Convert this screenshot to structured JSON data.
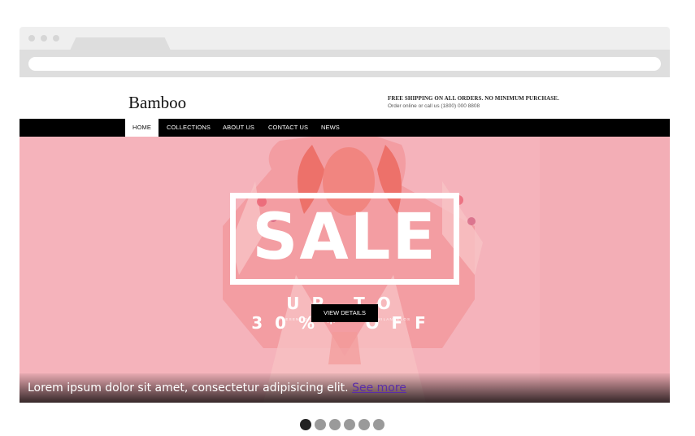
{
  "site": {
    "logo": "Bamboo",
    "promo_line1": "FREE SHIPPING ON ALL ORDERS. NO MINIMUM PURCHASE.",
    "promo_line2": "Order online or call us (1800) 000 8808"
  },
  "nav": {
    "items": [
      {
        "label": "HOME",
        "active": true
      },
      {
        "label": "COLLECTIONS",
        "active": false
      },
      {
        "label": "ABOUT US",
        "active": false
      },
      {
        "label": "CONTACT US",
        "active": false
      },
      {
        "label": "NEWS",
        "active": false
      }
    ]
  },
  "hero": {
    "sale_text": "SALE",
    "offer_text": "UP TO 30%* OFF",
    "fine_print": "PRESENT DAPIBUS ... ... ... ... ... ... MILANCELOS",
    "button_label": "VIEW DETAILS",
    "background_color": "#f5b3bb"
  },
  "caption": {
    "text": "Lorem ipsum dolor sit amet, consectetur adipisicing elit.",
    "link_text": "See more"
  },
  "carousel": {
    "slide_count": 6,
    "active_index": 0
  }
}
